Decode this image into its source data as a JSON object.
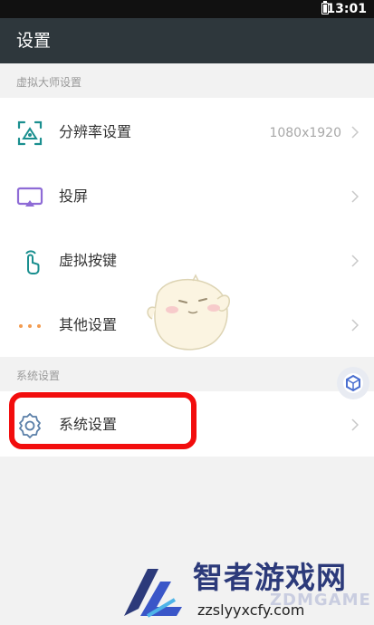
{
  "status_bar": {
    "time": "13:01"
  },
  "app_bar": {
    "title": "设置"
  },
  "sections": {
    "virtual_master": {
      "header": "虚拟大师设置",
      "items": [
        {
          "label": "分辨率设置",
          "value": "1080x1920",
          "icon": "resolution-icon"
        },
        {
          "label": "投屏",
          "icon": "cast-icon"
        },
        {
          "label": "虚拟按键",
          "icon": "touch-icon"
        },
        {
          "label": "其他设置",
          "icon": "more-dots-icon"
        }
      ]
    },
    "system": {
      "header": "系统设置",
      "items": [
        {
          "label": "系统设置",
          "icon": "gear-icon"
        }
      ]
    }
  },
  "colors": {
    "app_bar": "#2e373c",
    "accent_teal": "#1a8f8f",
    "accent_purple": "#8e6bd6",
    "accent_orange": "#f39c50",
    "highlight_red": "#f20d0d"
  },
  "watermark": {
    "brand": "智者游戏网",
    "brand_en": "ZDMGAME",
    "url": "zzslyyxcfy.com"
  }
}
